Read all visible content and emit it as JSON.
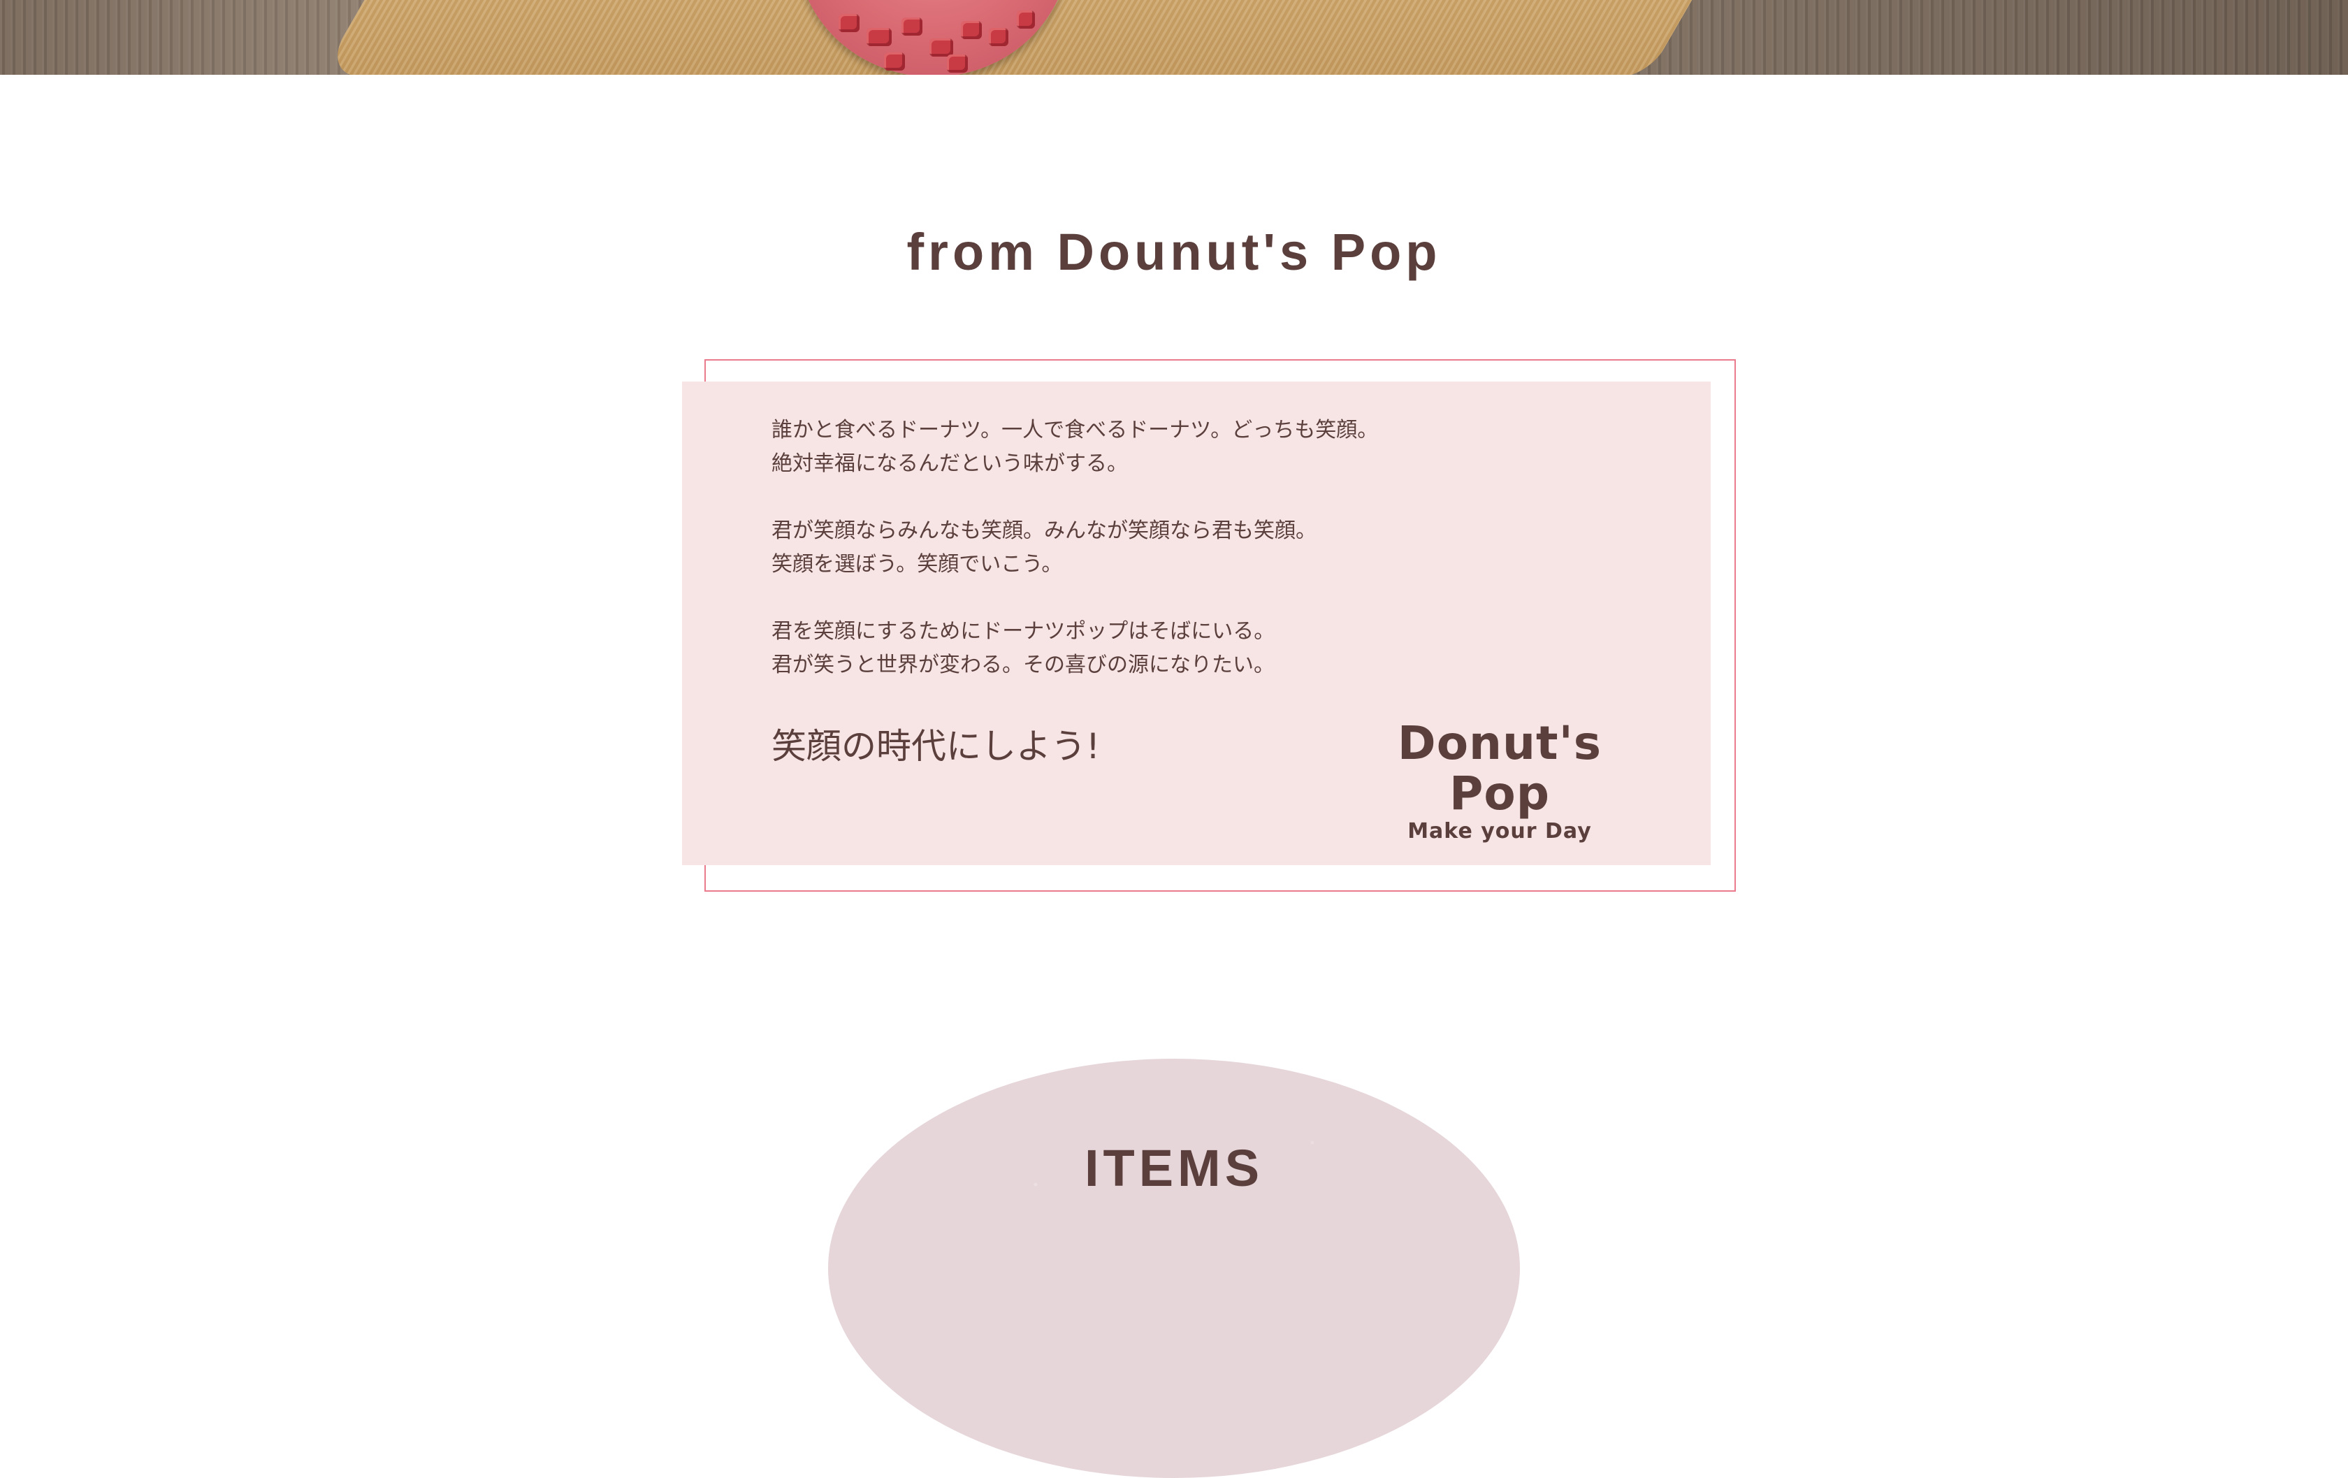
{
  "hero": {
    "image": "donut-on-wooden-board"
  },
  "about": {
    "title": "from Dounut's Pop",
    "paragraphs": [
      {
        "line1": "誰かと食べるドーナツ。一人で食べるドーナツ。どっちも笑顔。",
        "line2": "絶対幸福になるんだという味がする。"
      },
      {
        "line1": "君が笑顔ならみんなも笑顔。みんなが笑顔なら君も笑顔。",
        "line2": "笑顔を選ぼう。笑顔でいこう。"
      },
      {
        "line1": "君を笑顔にするためにドーナツポップはそばにいる。",
        "line2": "君が笑うと世界が変わる。その喜びの源になりたい。"
      }
    ],
    "slogan": "笑顔の時代にしよう!",
    "logo": {
      "name": "Donut's Pop",
      "tagline": "Make your Day"
    }
  },
  "items": {
    "title": "ITEMS"
  },
  "colors": {
    "text": "#5a3f3c",
    "card_bg": "#f7e5e5",
    "frame": "#ea7b8c",
    "blob": "#e6d5d9"
  }
}
